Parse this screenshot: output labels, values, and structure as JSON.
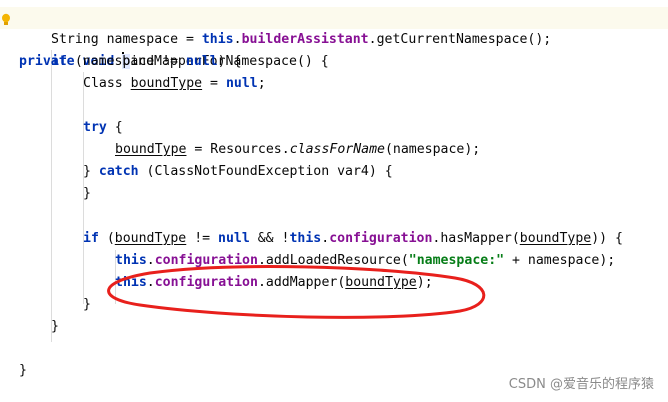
{
  "code": {
    "l1": {
      "kw_private": "private",
      "kw_void": "void",
      "method_first": "b",
      "method_rest": "indMapperForNamespace",
      "tail": "() {"
    },
    "l2": {
      "type": "String",
      "var": " namespace = ",
      "kw_this": "this",
      "dot": ".",
      "field": "builderAssistant",
      "call": ".getCurrentNamespace();"
    },
    "l3": {
      "kw_if": "if",
      "a": " (namespace != ",
      "kw_null": "null",
      "b": ") {"
    },
    "l4": {
      "type": "Class ",
      "var": "boundType",
      "a": " = ",
      "kw_null": "null",
      "b": ";"
    },
    "l6": {
      "kw_try": "try",
      "b": " {"
    },
    "l7": {
      "var": "boundType",
      "a": " = Resources.",
      "call": "classForName",
      "b": "(namespace);"
    },
    "l8": {
      "a": "} ",
      "kw_catch": "catch",
      "b": " (ClassNotFoundException var4) {"
    },
    "l9": {
      "a": "}"
    },
    "l11": {
      "kw_if": "if",
      "a": " (",
      "var1": "boundType",
      "b": " != ",
      "kw_null": "null",
      "c": " && !",
      "kw_this": "this",
      "d": ".",
      "field": "configuration",
      "e": ".hasMapper(",
      "var2": "boundType",
      "f": ")) {"
    },
    "l12": {
      "kw_this": "this",
      "d": ".",
      "field": "configuration",
      "e": ".addLoadedResource(",
      "str": "\"namespace:\"",
      "f": " + namespace);"
    },
    "l13": {
      "kw_this": "this",
      "d": ".",
      "field": "configuration",
      "e": ".addMapper(",
      "var": "boundType",
      "f": ");"
    },
    "l14": {
      "a": "}"
    },
    "l15": {
      "a": "}"
    },
    "l17": {
      "a": "}"
    }
  },
  "gutter": {
    "icon": "warning-bulb-icon"
  },
  "annotation": {
    "color": "#e8201c"
  },
  "watermark": "CSDN @爱音乐的程序猿"
}
